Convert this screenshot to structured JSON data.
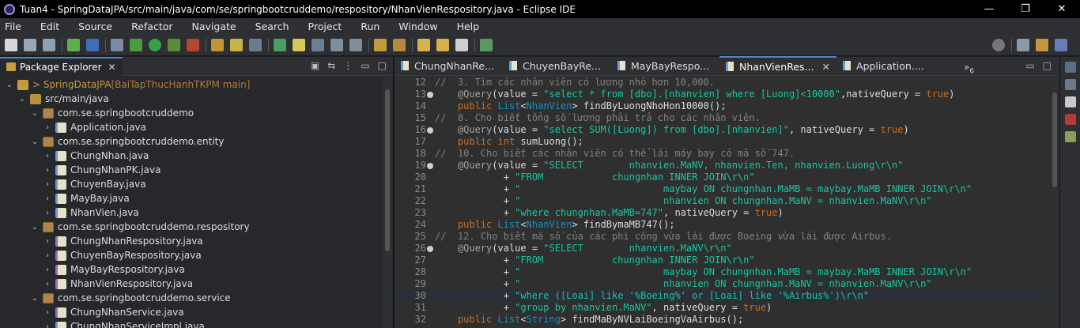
{
  "window": {
    "title": "Tuan4 - SpringDataJPA/src/main/java/com/se/springbootcruddemo/respository/NhanVienRespository.java - Eclipse IDE",
    "min_glyph": "—",
    "max_glyph": "❐",
    "close_glyph": "✕"
  },
  "menu": [
    "File",
    "Edit",
    "Source",
    "Refactor",
    "Navigate",
    "Search",
    "Project",
    "Run",
    "Window",
    "Help"
  ],
  "package_explorer": {
    "title": "Package Explorer",
    "close": "✕",
    "tree": [
      {
        "level": 0,
        "chev": "⌄",
        "icon": "project",
        "label": "> SpringDataJPA",
        "decor": " [BaiTapThucHanhTKPM main]"
      },
      {
        "level": 1,
        "chev": "⌄",
        "icon": "folder",
        "label": "src/main/java"
      },
      {
        "level": 2,
        "chev": "⌄",
        "icon": "pkg",
        "label": "com.se.springbootcruddemo"
      },
      {
        "level": 3,
        "chev": "›",
        "icon": "java",
        "label": "Application.java"
      },
      {
        "level": 2,
        "chev": "⌄",
        "icon": "pkg",
        "label": "com.se.springbootcruddemo.entity"
      },
      {
        "level": 3,
        "chev": "›",
        "icon": "java",
        "label": "ChungNhan.java"
      },
      {
        "level": 3,
        "chev": "›",
        "icon": "java",
        "label": "ChungNhanPK.java"
      },
      {
        "level": 3,
        "chev": "›",
        "icon": "java",
        "label": "ChuyenBay.java"
      },
      {
        "level": 3,
        "chev": "›",
        "icon": "java",
        "label": "MayBay.java"
      },
      {
        "level": 3,
        "chev": "›",
        "icon": "java",
        "label": "NhanVien.java"
      },
      {
        "level": 2,
        "chev": "⌄",
        "icon": "pkg",
        "label": "com.se.springbootcruddemo.respository"
      },
      {
        "level": 3,
        "chev": "›",
        "icon": "iface",
        "label": "ChungNhanRespository.java"
      },
      {
        "level": 3,
        "chev": "›",
        "icon": "iface",
        "label": "ChuyenBayRespository.java"
      },
      {
        "level": 3,
        "chev": "›",
        "icon": "iface",
        "label": "MayBayRespository.java"
      },
      {
        "level": 3,
        "chev": "›",
        "icon": "iface",
        "label": "NhanVienRespository.java"
      },
      {
        "level": 2,
        "chev": "⌄",
        "icon": "pkg",
        "label": "com.se.springbootcruddemo.service"
      },
      {
        "level": 3,
        "chev": "›",
        "icon": "iface",
        "label": "ChungNhanService.java"
      },
      {
        "level": 3,
        "chev": "›",
        "icon": "java",
        "label": "ChungNhanServiceImpl.java"
      }
    ]
  },
  "editor": {
    "tabs": [
      {
        "label": "ChungNhanRe...",
        "active": false
      },
      {
        "label": "ChuyenBayRe...",
        "active": false
      },
      {
        "label": "MayBayRespo...",
        "active": false
      },
      {
        "label": "NhanVienRes...",
        "active": true
      },
      {
        "label": "Application....",
        "active": false
      }
    ],
    "tab_close": "✕",
    "overflow_label": "»",
    "overflow_count": "6",
    "lines": [
      {
        "n": "12",
        "fold": false,
        "current": false,
        "tokens": [
          [
            "cm",
            "//  3. Tìm các nhân viên có lương nhỏ hơn 10,000."
          ]
        ]
      },
      {
        "n": "13",
        "fold": true,
        "current": false,
        "tokens": [
          [
            "",
            "    "
          ],
          [
            "ann",
            "@Query"
          ],
          [
            "",
            "(value = "
          ],
          [
            "str",
            "\"select * from [dbo].[nhanvien] where [Luong]<10000\""
          ],
          [
            "",
            ",nativeQuery = "
          ],
          [
            "kw",
            "true"
          ],
          [
            "",
            ")"
          ]
        ]
      },
      {
        "n": "14",
        "fold": false,
        "current": false,
        "tokens": [
          [
            "",
            "    "
          ],
          [
            "kw",
            "public"
          ],
          [
            "",
            " "
          ],
          [
            "type",
            "List"
          ],
          [
            "",
            "<"
          ],
          [
            "type",
            "NhanVien"
          ],
          [
            "",
            "> findByLuongNhoHon10000();"
          ]
        ]
      },
      {
        "n": "15",
        "fold": false,
        "current": false,
        "tokens": [
          [
            "cm",
            "//  8. Cho biết tổng số lương phải trả cho các nhân viên."
          ]
        ]
      },
      {
        "n": "16",
        "fold": true,
        "current": false,
        "tokens": [
          [
            "",
            "    "
          ],
          [
            "ann",
            "@Query"
          ],
          [
            "",
            "(value = "
          ],
          [
            "str",
            "\"select SUM([Luong]) from [dbo].[nhanvien]\""
          ],
          [
            "",
            ", nativeQuery = "
          ],
          [
            "kw",
            "true"
          ],
          [
            "",
            ")"
          ]
        ]
      },
      {
        "n": "17",
        "fold": false,
        "current": false,
        "tokens": [
          [
            "",
            "    "
          ],
          [
            "kw",
            "public"
          ],
          [
            "",
            " "
          ],
          [
            "kw",
            "int"
          ],
          [
            "",
            " sumLuong();"
          ]
        ]
      },
      {
        "n": "18",
        "fold": false,
        "current": false,
        "tokens": [
          [
            "cm",
            "//  10. Cho biết các nhân viên có thể lái máy bay có mã số 747."
          ]
        ]
      },
      {
        "n": "19",
        "fold": true,
        "current": false,
        "tokens": [
          [
            "",
            "    "
          ],
          [
            "ann",
            "@Query"
          ],
          [
            "",
            "(value = "
          ],
          [
            "str",
            "\"SELECT        nhanvien.MaNV, nhanvien.Ten, nhanvien.Luong\\r\\n\""
          ]
        ]
      },
      {
        "n": "20",
        "fold": false,
        "current": false,
        "tokens": [
          [
            "",
            "            + "
          ],
          [
            "str",
            "\"FROM            chungnhan INNER JOIN\\r\\n\""
          ]
        ]
      },
      {
        "n": "21",
        "fold": false,
        "current": false,
        "tokens": [
          [
            "",
            "            + "
          ],
          [
            "str",
            "\"                         maybay ON chungnhan.MaMB = maybay.MaMB INNER JOIN\\r\\n\""
          ]
        ]
      },
      {
        "n": "22",
        "fold": false,
        "current": false,
        "tokens": [
          [
            "",
            "            + "
          ],
          [
            "str",
            "\"                         nhanvien ON chungnhan.MaNV = nhanvien.MaNV\\r\\n\""
          ]
        ]
      },
      {
        "n": "23",
        "fold": false,
        "current": false,
        "tokens": [
          [
            "",
            "            + "
          ],
          [
            "str",
            "\"where chungnhan.MaMB=747\""
          ],
          [
            "",
            ", nativeQuery = "
          ],
          [
            "kw",
            "true"
          ],
          [
            "",
            ")"
          ]
        ]
      },
      {
        "n": "24",
        "fold": false,
        "current": false,
        "tokens": [
          [
            "",
            "    "
          ],
          [
            "kw",
            "public"
          ],
          [
            "",
            " "
          ],
          [
            "type",
            "List"
          ],
          [
            "",
            "<"
          ],
          [
            "type",
            "NhanVien"
          ],
          [
            "",
            "> findBymaMB747();"
          ]
        ]
      },
      {
        "n": "25",
        "fold": false,
        "current": false,
        "tokens": [
          [
            "cm",
            "//  12. Cho biết mã số của các phi công vừa lái được Boeing vừa lái được Airbus."
          ]
        ]
      },
      {
        "n": "26",
        "fold": true,
        "current": false,
        "tokens": [
          [
            "",
            "    "
          ],
          [
            "ann",
            "@Query"
          ],
          [
            "",
            "(value = "
          ],
          [
            "str",
            "\"SELECT        nhanvien.MaNV\\r\\n\""
          ]
        ]
      },
      {
        "n": "27",
        "fold": false,
        "current": false,
        "tokens": [
          [
            "",
            "            + "
          ],
          [
            "str",
            "\"FROM            chungnhan INNER JOIN\\r\\n\""
          ]
        ]
      },
      {
        "n": "28",
        "fold": false,
        "current": false,
        "tokens": [
          [
            "",
            "            + "
          ],
          [
            "str",
            "\"                         maybay ON chungnhan.MaMB = maybay.MaMB INNER JOIN\\r\\n\""
          ]
        ]
      },
      {
        "n": "29",
        "fold": false,
        "current": false,
        "tokens": [
          [
            "",
            "            + "
          ],
          [
            "str",
            "\"                         nhanvien ON chungnhan.MaNV = nhanvien.MaNV\\r\\n\""
          ]
        ]
      },
      {
        "n": "30",
        "fold": false,
        "current": true,
        "tokens": [
          [
            "",
            "            + "
          ],
          [
            "str",
            "\"where ([Loai] like '%Boeing%' or [Loai] like '%Airbus%')\\r\\n\""
          ]
        ]
      },
      {
        "n": "31",
        "fold": false,
        "current": false,
        "tokens": [
          [
            "",
            "            + "
          ],
          [
            "str",
            "\"group by nhanvien.MaNV\""
          ],
          [
            "",
            ", nativeQuery = "
          ],
          [
            "kw",
            "true"
          ],
          [
            "",
            ")"
          ]
        ]
      },
      {
        "n": "32",
        "fold": false,
        "current": false,
        "tokens": [
          [
            "",
            "    "
          ],
          [
            "kw",
            "public"
          ],
          [
            "",
            " "
          ],
          [
            "type",
            "List"
          ],
          [
            "",
            "<"
          ],
          [
            "type",
            "String"
          ],
          [
            "",
            "> findMaByNVLaiBoeingVaAirbus();"
          ]
        ]
      }
    ]
  },
  "colors": {
    "accent": "#4a88c7",
    "keyword": "#cc6c1d",
    "string": "#17c6a3",
    "comment": "#808080",
    "type": "#1290c3"
  }
}
